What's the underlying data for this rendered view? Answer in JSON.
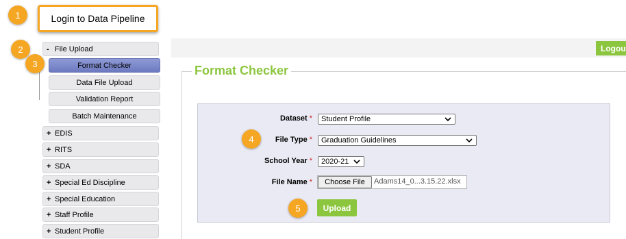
{
  "callouts": [
    "1",
    "2",
    "3",
    "4",
    "5"
  ],
  "login_button": "Login to Data Pipeline",
  "header": {
    "logout_label": "Logout"
  },
  "page_title": "Format Checker",
  "sidebar": {
    "expanded_group": {
      "symbol": "-",
      "label": "File Upload"
    },
    "sub_items": [
      "Format Checker",
      "Data File Upload",
      "Validation Report",
      "Batch Maintenance"
    ],
    "active_sub_item": "Format Checker",
    "collapsed_groups": [
      {
        "symbol": "+",
        "label": "EDIS"
      },
      {
        "symbol": "+",
        "label": "RITS"
      },
      {
        "symbol": "+",
        "label": "SDA"
      },
      {
        "symbol": "+",
        "label": "Special Ed Discipline"
      },
      {
        "symbol": "+",
        "label": "Special Education"
      },
      {
        "symbol": "+",
        "label": "Staff Profile"
      },
      {
        "symbol": "+",
        "label": "Student Profile"
      }
    ]
  },
  "form": {
    "dataset": {
      "label": "Dataset",
      "required_mark": "*",
      "value": "Student Profile"
    },
    "file_type": {
      "label": "File Type",
      "required_mark": "*",
      "value": "Graduation Guidelines"
    },
    "school_year": {
      "label": "School Year",
      "required_mark": "*",
      "value": "2020-21"
    },
    "file_name": {
      "label": "File Name",
      "required_mark": "*",
      "button_label": "Choose File",
      "value": "Adams14_0...3.15.22.xlsx"
    },
    "upload_label": "Upload"
  },
  "icons": {
    "dropdown": "chevron-down-icon",
    "expand": "plus-icon",
    "collapse": "minus-icon"
  },
  "colors": {
    "accent_green": "#8cc63f",
    "callout_orange": "#f5a623",
    "active_nav": "#7a88cc",
    "required": "#d02020"
  }
}
